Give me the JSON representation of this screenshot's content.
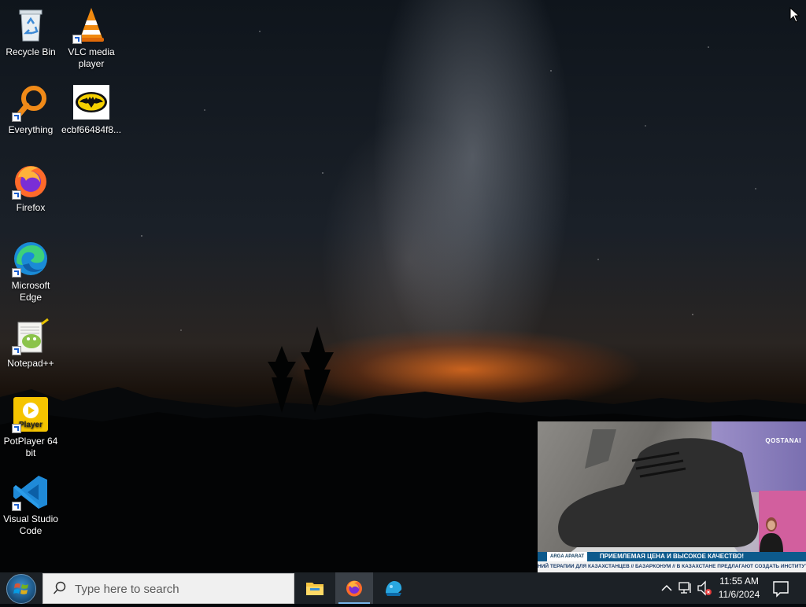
{
  "desktop": {
    "icons": [
      {
        "label": "Recycle Bin",
        "icon": "recycle-bin-icon"
      },
      {
        "label": "VLC media player",
        "icon": "vlc-icon"
      },
      {
        "label": "Everything",
        "icon": "everything-search-icon"
      },
      {
        "label": "ecbf66484f8...",
        "icon": "batman-image-icon"
      },
      {
        "label": "Firefox",
        "icon": "firefox-icon"
      },
      {
        "label": "Microsoft Edge",
        "icon": "edge-icon"
      },
      {
        "label": "Notepad++",
        "icon": "notepad-plus-plus-icon"
      },
      {
        "label": "PotPlayer 64 bit",
        "icon": "potplayer-icon"
      },
      {
        "label": "Visual Studio Code",
        "icon": "vscode-icon"
      }
    ]
  },
  "video_overlay": {
    "channel": "QOSTANAI",
    "tag": "ARGA APARAT",
    "headline": "ПРИЕМЛЕМАЯ ЦЕНА И ВЫСОКОЕ КАЧЕСТВО!",
    "ticker": "НИЙ ТЕРАПИИ ДЛЯ КАЗАХСТАНЦЕВ // БАЗАРКОНУМ // В КАЗАХСТАНЕ ПРЕДЛАГАЮТ СОЗДАТЬ ИНСТИТУТ ПРЕ"
  },
  "taskbar": {
    "search_placeholder": "Type here to search",
    "apps": [
      {
        "name": "File Explorer",
        "icon": "folder-icon",
        "active": false
      },
      {
        "name": "Firefox",
        "icon": "firefox-icon",
        "active": true
      },
      {
        "name": "Other app",
        "icon": "blue-app-icon",
        "active": false
      }
    ],
    "time": "11:55 AM",
    "date": "11/6/2024"
  },
  "colors": {
    "taskbar_bg": "#1c2126",
    "active_underline": "#77b4e8",
    "search_bg": "#f0f0f0"
  }
}
